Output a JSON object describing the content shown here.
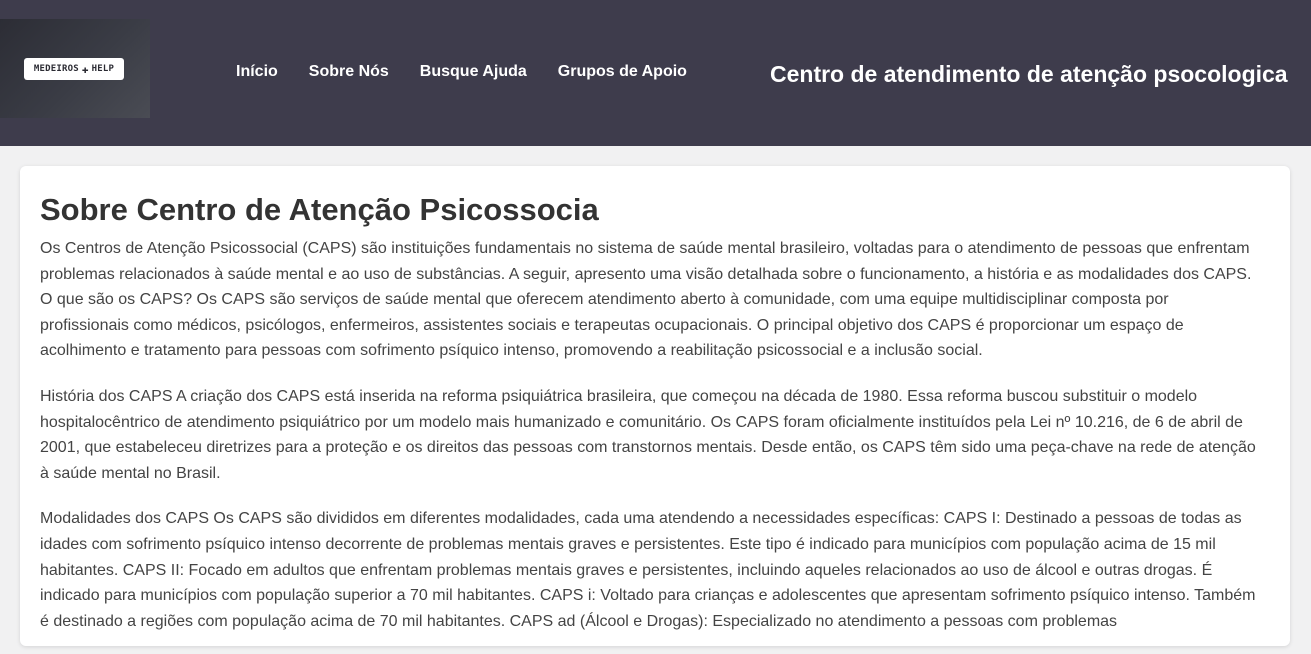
{
  "header": {
    "logo_text_left": "MEDEIROS",
    "logo_text_right": "HELP",
    "nav": [
      {
        "label": "Início"
      },
      {
        "label": "Sobre Nós"
      },
      {
        "label": "Busque Ajuda"
      },
      {
        "label": "Grupos de Apoio"
      }
    ],
    "site_title": "Centro de atendimento de atenção psocologica"
  },
  "main": {
    "title": "Sobre Centro de Atenção Psicossocia",
    "paragraphs": [
      "Os Centros de Atenção Psicossocial (CAPS) são instituições fundamentais no sistema de saúde mental brasileiro, voltadas para o atendimento de pessoas que enfrentam problemas relacionados à saúde mental e ao uso de substâncias. A seguir, apresento uma visão detalhada sobre o funcionamento, a história e as modalidades dos CAPS. O que são os CAPS? Os CAPS são serviços de saúde mental que oferecem atendimento aberto à comunidade, com uma equipe multidisciplinar composta por profissionais como médicos, psicólogos, enfermeiros, assistentes sociais e terapeutas ocupacionais. O principal objetivo dos CAPS é proporcionar um espaço de acolhimento e tratamento para pessoas com sofrimento psíquico intenso, promovendo a reabilitação psicossocial e a inclusão social.",
      "História dos CAPS A criação dos CAPS está inserida na reforma psiquiátrica brasileira, que começou na década de 1980. Essa reforma buscou substituir o modelo hospitalocêntrico de atendimento psiquiátrico por um modelo mais humanizado e comunitário. Os CAPS foram oficialmente instituídos pela Lei nº 10.216, de 6 de abril de 2001, que estabeleceu diretrizes para a proteção e os direitos das pessoas com transtornos mentais. Desde então, os CAPS têm sido uma peça-chave na rede de atenção à saúde mental no Brasil.",
      "Modalidades dos CAPS Os CAPS são divididos em diferentes modalidades, cada uma atendendo a necessidades específicas: CAPS I: Destinado a pessoas de todas as idades com sofrimento psíquico intenso decorrente de problemas mentais graves e persistentes. Este tipo é indicado para municípios com população acima de 15 mil habitantes. CAPS II: Focado em adultos que enfrentam problemas mentais graves e persistentes, incluindo aqueles relacionados ao uso de álcool e outras drogas. É indicado para municípios com população superior a 70 mil habitantes. CAPS i: Voltado para crianças e adolescentes que apresentam sofrimento psíquico intenso. Também é destinado a regiões com população acima de 70 mil habitantes. CAPS ad (Álcool e Drogas): Especializado no atendimento a pessoas com problemas"
    ]
  },
  "colors": {
    "header_bg": "#3e3c4c",
    "page_bg": "#f1f1f2",
    "card_bg": "#ffffff",
    "title_text": "#333333",
    "body_text": "#444444"
  }
}
